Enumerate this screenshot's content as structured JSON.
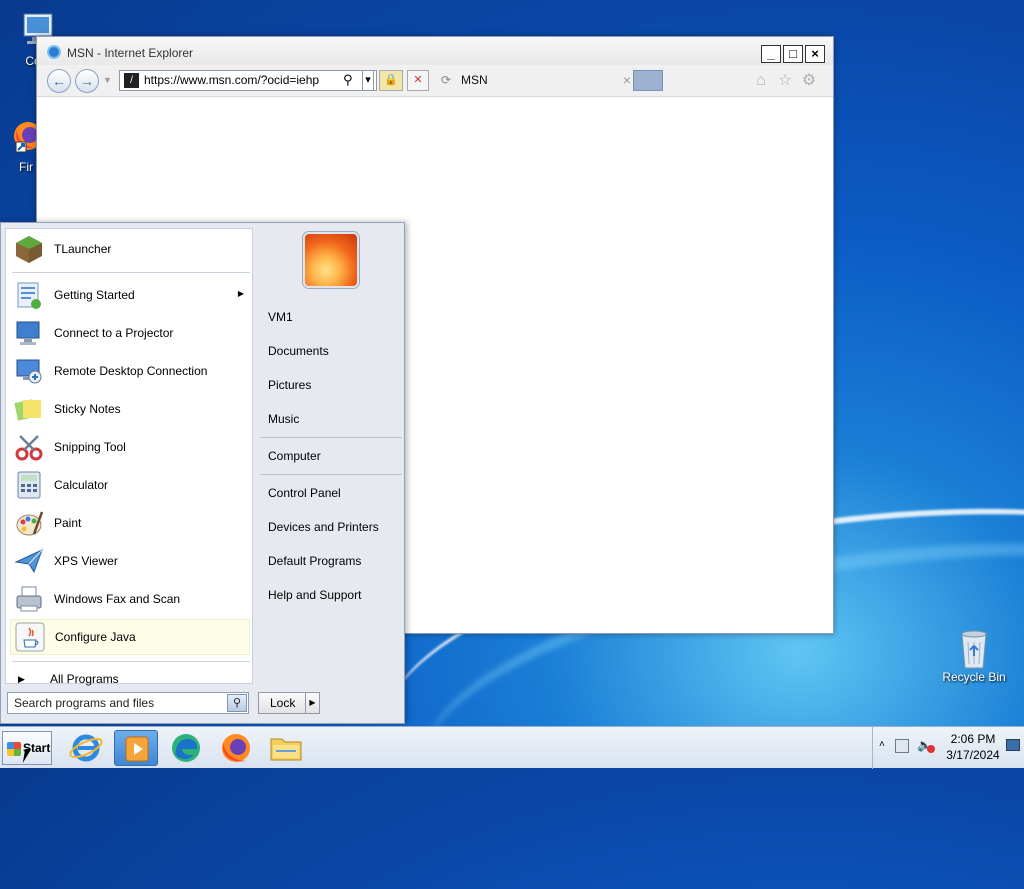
{
  "desktop": {
    "icons": [
      {
        "label": "Com"
      },
      {
        "label": "Fir"
      },
      {
        "label": "Recycle Bin"
      }
    ]
  },
  "browser": {
    "window_title": "MSN - Internet Explorer",
    "address": "https://www.msn.com/?ocid=iehp",
    "tab_title": "MSN",
    "tab_close": "×",
    "window_buttons": {
      "minimize": "_",
      "maximize": "□",
      "close": "×"
    }
  },
  "start_menu": {
    "pinned": [
      {
        "label": "TLauncher"
      }
    ],
    "programs": [
      {
        "label": "Getting Started",
        "has_submenu": true
      },
      {
        "label": "Connect to a Projector"
      },
      {
        "label": "Remote Desktop Connection"
      },
      {
        "label": "Sticky Notes"
      },
      {
        "label": "Snipping Tool"
      },
      {
        "label": "Calculator"
      },
      {
        "label": "Paint"
      },
      {
        "label": "XPS Viewer"
      },
      {
        "label": "Windows Fax and Scan"
      },
      {
        "label": "Configure Java",
        "highlighted": true
      }
    ],
    "all_programs": "All Programs",
    "search_placeholder": "Search programs and files",
    "right_links": [
      "VM1",
      "Documents",
      "Pictures",
      "Music",
      "Computer",
      "Control Panel",
      "Devices and Printers",
      "Default Programs",
      "Help and Support"
    ],
    "lock_label": "Lock"
  },
  "taskbar": {
    "start_label": "Start",
    "apps": [
      "internet-explorer",
      "media-player",
      "edge",
      "firefox",
      "file-explorer"
    ],
    "clock": {
      "time": "2:06 PM",
      "date": "3/17/2024"
    }
  },
  "colors": {
    "desktop_blue": "#0a47a8",
    "menu_bg": "#e6eaf0",
    "highlight": "#fdfde8",
    "taskbar_active": "#3f86d3"
  }
}
